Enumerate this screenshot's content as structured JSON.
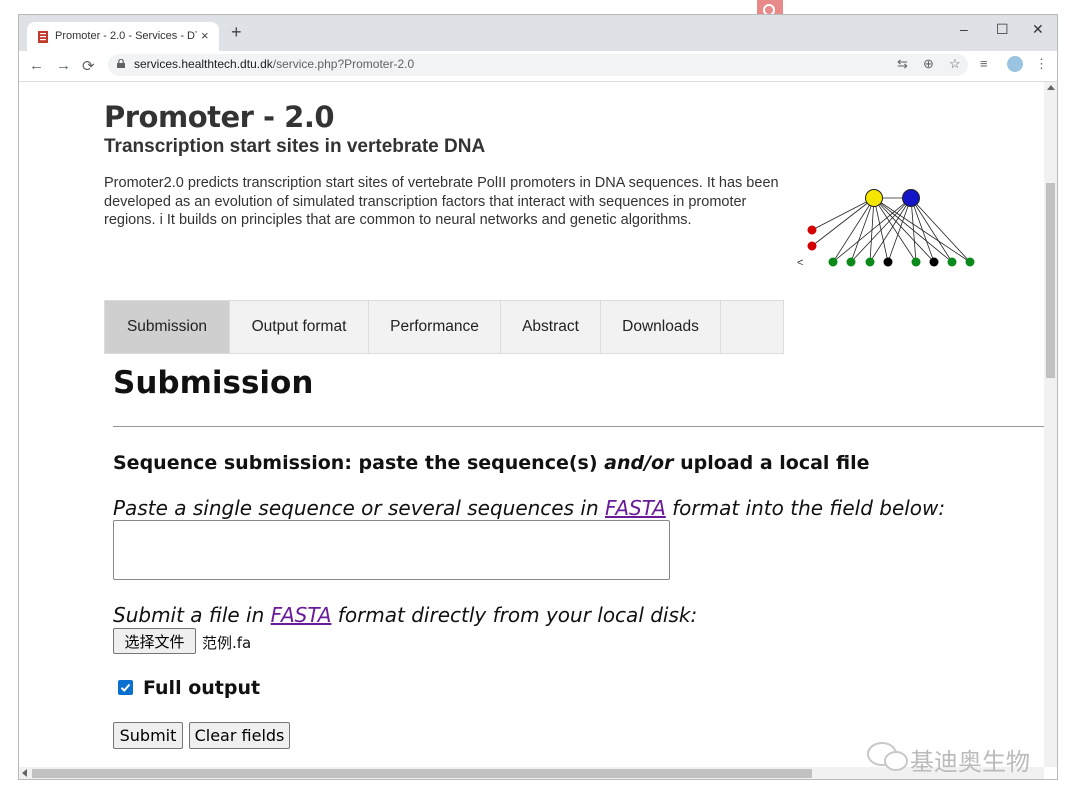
{
  "browser": {
    "tab_title": "Promoter - 2.0 - Services - DTU",
    "tab_close": "×",
    "new_tab": "+",
    "window_controls": {
      "minimize": "–",
      "maximize": "☐",
      "close": "✕"
    },
    "nav": {
      "back": "←",
      "forward": "→",
      "reload": "⟳"
    },
    "url_host": "services.healthtech.dtu.dk",
    "url_path": "/service.php?Promoter-2.0",
    "toolbar_icons": [
      "translate-icon",
      "zoom-icon",
      "bookmark-star-icon",
      "reading-list-icon",
      "profile-avatar",
      "menu-dots-icon"
    ],
    "glyphs": {
      "translate": "⇆",
      "zoom": "⊕",
      "star": "☆",
      "list": "≡",
      "menu": "⋮"
    }
  },
  "page": {
    "title": "Promoter - 2.0",
    "subtitle": "Transcription start sites in vertebrate DNA",
    "intro": "Promoter2.0 predicts transcription start sites of vertebrate PolII promoters in DNA sequences. It has been developed as an evolution of simulated transcription factors that interact with sequences in promoter regions. i It builds on principles that are common to neural networks and genetic algorithms.",
    "figure_label": "<",
    "tabs": [
      {
        "label": "Submission",
        "active": true
      },
      {
        "label": "Output format"
      },
      {
        "label": "Performance"
      },
      {
        "label": "Abstract"
      },
      {
        "label": "Downloads"
      }
    ]
  },
  "submission": {
    "heading": "Submission",
    "seq_heading_pre": "Sequence submission: paste the sequence(s) ",
    "seq_heading_em": "and/or",
    "seq_heading_post": " upload a local file",
    "paste_pre": "Paste a single sequence or several sequences in ",
    "paste_link": "FASTA",
    "paste_post": " format into the field below:",
    "textarea_value": "",
    "file_pre": "Submit a file in ",
    "file_link": "FASTA",
    "file_post": " format directly from your local disk:",
    "file_button": "选择文件",
    "file_name": "范例.fa",
    "full_output_label": "Full output",
    "full_output_checked": true,
    "submit_label": "Submit",
    "clear_label": "Clear fields"
  },
  "overlay": {
    "watermark": "基迪奥生物"
  },
  "colors": {
    "accent_checkbox": "#0b6fcf",
    "link": "#6a1b9a",
    "node_yellow": "#f5e600",
    "node_blue": "#1515c8",
    "node_red": "#d40000",
    "node_green": "#0a8a1a",
    "node_black": "#000000"
  }
}
